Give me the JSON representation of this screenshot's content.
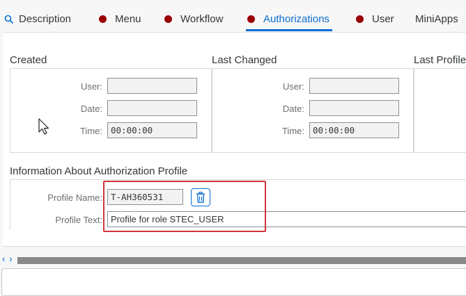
{
  "tabs": [
    {
      "label": "Description",
      "icon": "search-icon",
      "active": false
    },
    {
      "label": "Menu",
      "icon": "status-dot-icon",
      "active": false
    },
    {
      "label": "Workflow",
      "icon": "status-dot-icon",
      "active": false
    },
    {
      "label": "Authorizations",
      "icon": "status-dot-icon",
      "active": true
    },
    {
      "label": "User",
      "icon": "status-dot-icon",
      "active": false
    },
    {
      "label": "MiniApps",
      "active": false
    }
  ],
  "created": {
    "title": "Created",
    "user_label": "User:",
    "user_value": "",
    "date_label": "Date:",
    "date_value": "",
    "time_label": "Time:",
    "time_value": "00:00:00"
  },
  "last_changed": {
    "title": "Last Changed",
    "user_label": "User:",
    "user_value": "",
    "date_label": "Date:",
    "date_value": "",
    "time_label": "Time:",
    "time_value": "00:00:00"
  },
  "last_profile": {
    "title": "Last Profile"
  },
  "auth_profile": {
    "title": "Information About Authorization Profile",
    "name_label": "Profile Name:",
    "name_value": "T-AH360531",
    "text_label": "Profile Text:",
    "text_value": "Profile for role STEC_USER",
    "delete_icon": "trash-icon"
  },
  "scroll": {
    "left": "‹",
    "right": "›"
  },
  "colors": {
    "accent": "#0a6ed1",
    "status_dot": "#9b0000",
    "highlight": "#d0343a"
  }
}
